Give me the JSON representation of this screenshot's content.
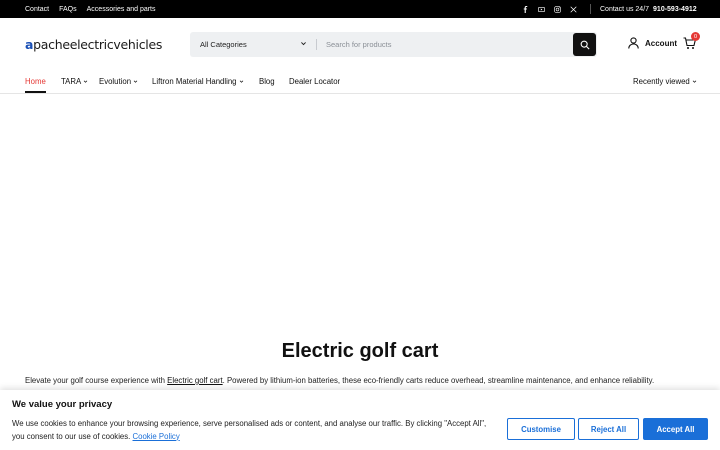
{
  "topbar": {
    "links": [
      "Contact",
      "FAQs",
      "Accessories and parts"
    ],
    "contact_label": "Contact us 24/7",
    "phone": "910-593-4912",
    "social_icons": [
      "facebook-icon",
      "youtube-icon",
      "instagram-icon",
      "x-icon"
    ]
  },
  "header": {
    "logo_mark": "a",
    "logo_text": "pacheelectricvehicles",
    "search": {
      "category": "All Categories",
      "placeholder": "Search for products"
    },
    "account_label": "Account",
    "cart_count": "0"
  },
  "nav": {
    "items": [
      {
        "label": "Home",
        "active": true,
        "dropdown": false
      },
      {
        "label": "TARA",
        "dropdown": true
      },
      {
        "label": "Evolution",
        "dropdown": true
      },
      {
        "label": "Liftron Material Handling",
        "dropdown": true
      },
      {
        "label": "Blog",
        "dropdown": false
      },
      {
        "label": "Dealer Locator",
        "dropdown": false
      }
    ],
    "recently_viewed": "Recently viewed"
  },
  "main": {
    "title": "Electric golf cart",
    "desc_before": "Elevate your golf course experience with ",
    "desc_link": "Electric golf cart",
    "desc_after": ". Powered by lithium-ion batteries, these eco-friendly carts reduce overhead, streamline maintenance, and enhance reliability."
  },
  "cookie": {
    "title": "We value your privacy",
    "text": "We use cookies to enhance your browsing experience, serve personalised ads or content, and analyse our traffic. By clicking \"Accept All\", you consent to our use of cookies. ",
    "policy_link": "Cookie Policy",
    "customise": "Customise",
    "reject": "Reject All",
    "accept": "Accept All"
  },
  "colors": {
    "accent": "#1a6fd8",
    "active_nav": "#e53935",
    "badge": "#e53935"
  }
}
